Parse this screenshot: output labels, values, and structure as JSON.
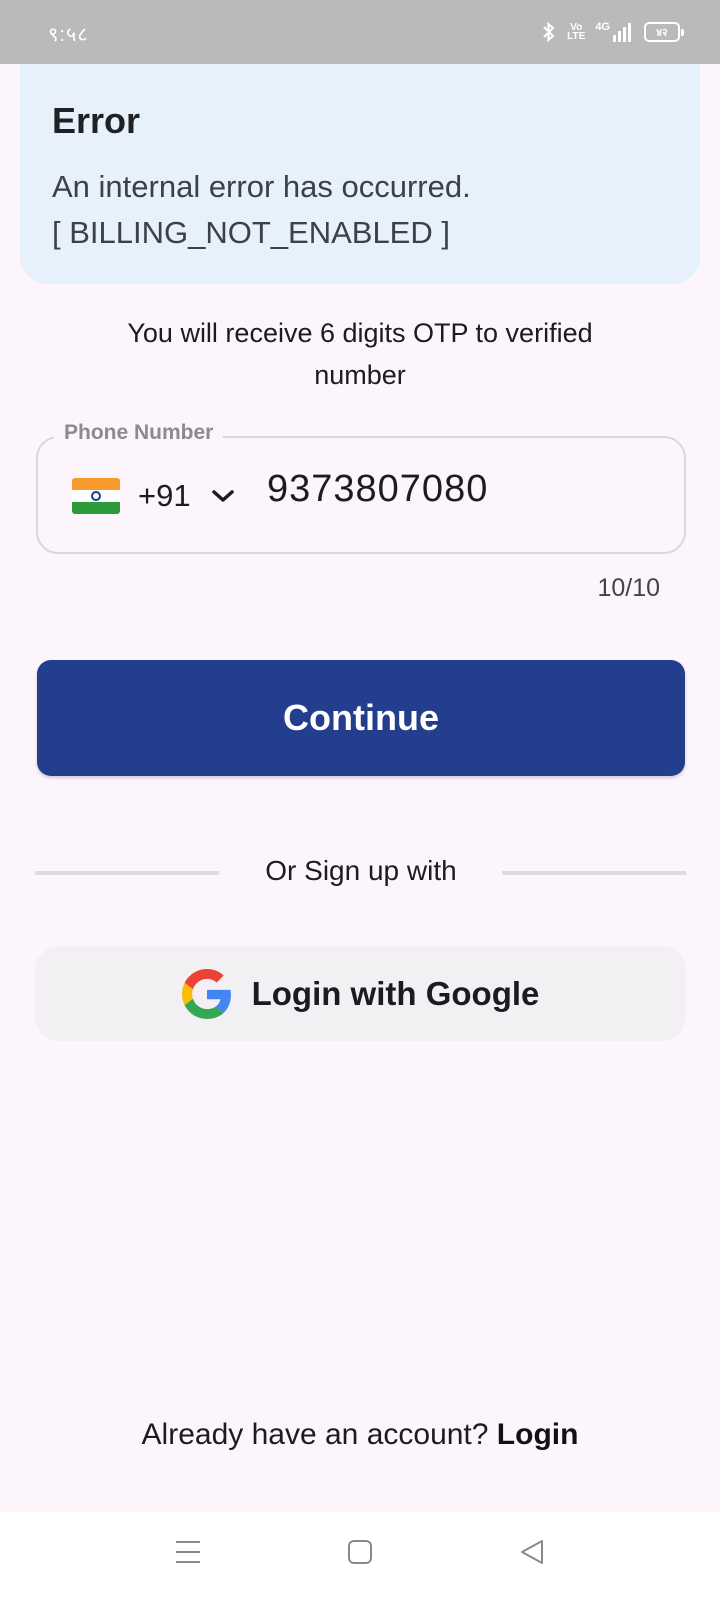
{
  "status_bar": {
    "time": "९:५८",
    "volte": "Vo\nLTE",
    "network": "4G",
    "battery": "४२"
  },
  "error": {
    "title": "Error",
    "message": "An internal error has occurred.\n[ BILLING_NOT_ENABLED ]"
  },
  "otp_info": "You will receive 6 digits OTP to verified number",
  "phone_field": {
    "label": "Phone Number",
    "dial_code": "+91",
    "value": "9373807080",
    "counter": "10/10"
  },
  "continue_button": {
    "label": "Continue"
  },
  "divider": {
    "text": "Or Sign up with"
  },
  "google_button": {
    "label": "Login with Google"
  },
  "footer": {
    "prompt": "Already have an account?",
    "login_label": "Login"
  },
  "colors": {
    "primary": "#233e8d",
    "error_card": "#e6f1fb",
    "background": "#fcf6fc"
  },
  "icons": {
    "status": [
      "bluetooth-icon",
      "volte-icon",
      "signal-icon",
      "battery-icon"
    ],
    "nav": [
      "menu-icon",
      "home-icon",
      "back-icon"
    ]
  }
}
